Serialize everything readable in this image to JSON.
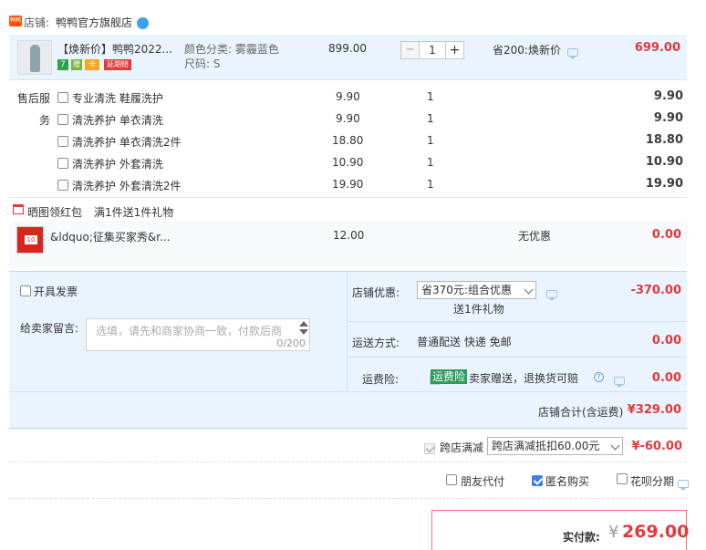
{
  "shop": {
    "label": "店铺:",
    "name": "鸭鸭官方旗舰店",
    "tag": "鸭鸭"
  },
  "item": {
    "title": "【焕新价】鸭鸭2022...",
    "color_label": "颜色分类: 雾霾蓝色",
    "size_label": "尺码: S",
    "price": "899.00",
    "qty": "1",
    "discount": "省200:焕新价",
    "total": "699.00",
    "badges": [
      "7",
      "赠",
      "卡",
      "延期赔"
    ]
  },
  "after_sales": {
    "label_line1": "售后服",
    "label_line2": "务",
    "options": [
      {
        "name": "专业清洗 鞋履洗护",
        "price": "9.90",
        "qty": "1",
        "total": "9.90"
      },
      {
        "name": "清洗养护 单衣清洗",
        "price": "9.90",
        "qty": "1",
        "total": "9.90"
      },
      {
        "name": "清洗养护 单衣清洗2件",
        "price": "18.80",
        "qty": "1",
        "total": "18.80"
      },
      {
        "name": "清洗养护 外套清洗",
        "price": "10.90",
        "qty": "1",
        "total": "10.90"
      },
      {
        "name": "清洗养护 外套清洗2件",
        "price": "19.90",
        "qty": "1",
        "total": "19.90"
      }
    ]
  },
  "gift": {
    "label": "晒图领红包",
    "desc": "满1件送1件礼物"
  },
  "gift_item": {
    "title": "&ldquo;征集买家秀&r...",
    "price": "12.00",
    "discount": "无优惠",
    "total": "0.00",
    "thumb_text": "10"
  },
  "invoice": {
    "label": "开具发票"
  },
  "message": {
    "label": "给卖家留言:",
    "placeholder": "选填，请先和商家协商一致，付款后商",
    "counter": "0/200"
  },
  "shop_discount": {
    "label": "店铺优惠:",
    "select": "省370元:组合优惠",
    "sub": "送1件礼物",
    "amount": "-370.00"
  },
  "shipping": {
    "label": "运送方式:",
    "value": "普通配送 快递 免邮",
    "amount": "0.00"
  },
  "insurance": {
    "label": "运费险:",
    "tag": "运费险",
    "desc": "卖家赠送，退换货可赔",
    "amount": "0.00"
  },
  "shop_total": {
    "label": "店铺合计(含运费)",
    "amount": "¥329.00"
  },
  "cross_shop": {
    "label": "跨店满减",
    "select": "跨店满减抵扣60.00元",
    "amount": "¥-60.00"
  },
  "options": {
    "friend_pay": "朋友代付",
    "anonymous": "匿名购买",
    "huabei": "花呗分期"
  },
  "payment": {
    "label": "实付款:",
    "currency": "¥",
    "amount": "269.00"
  },
  "colors": {
    "accent_red": "#e4393c",
    "blue_bg": "#eaf4fe",
    "border": "#b8d6f1"
  }
}
